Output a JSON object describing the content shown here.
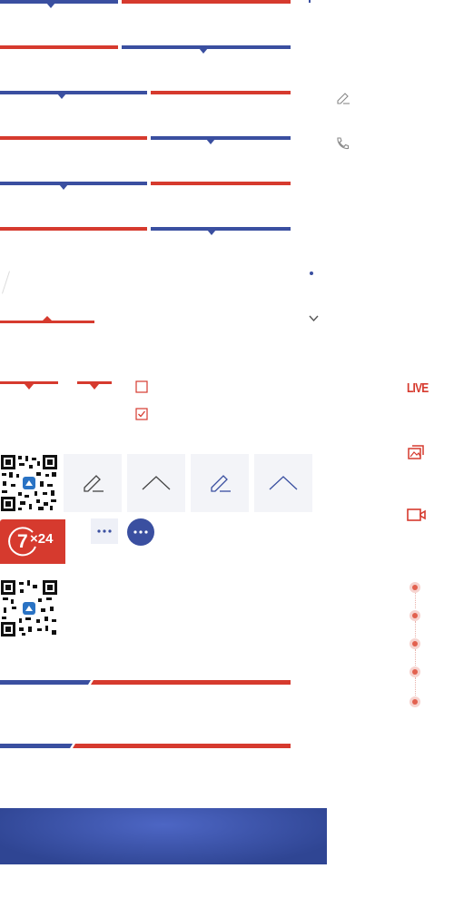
{
  "badge": {
    "text_big": "7",
    "text_small": "×24"
  },
  "live_label": "LIVE",
  "colors": {
    "red": "#d63a2e",
    "blue": "#3a4fa0",
    "tile_bg": "#f3f4f8",
    "banner": "#3b52a8"
  },
  "icons": [
    "pencil-icon",
    "phone-icon",
    "chevron-down-icon",
    "checkbox-empty-icon",
    "checkbox-checked-icon",
    "chevron-up-icon",
    "more-icon",
    "image-gallery-icon",
    "video-camera-icon",
    "qr-code-icon"
  ]
}
